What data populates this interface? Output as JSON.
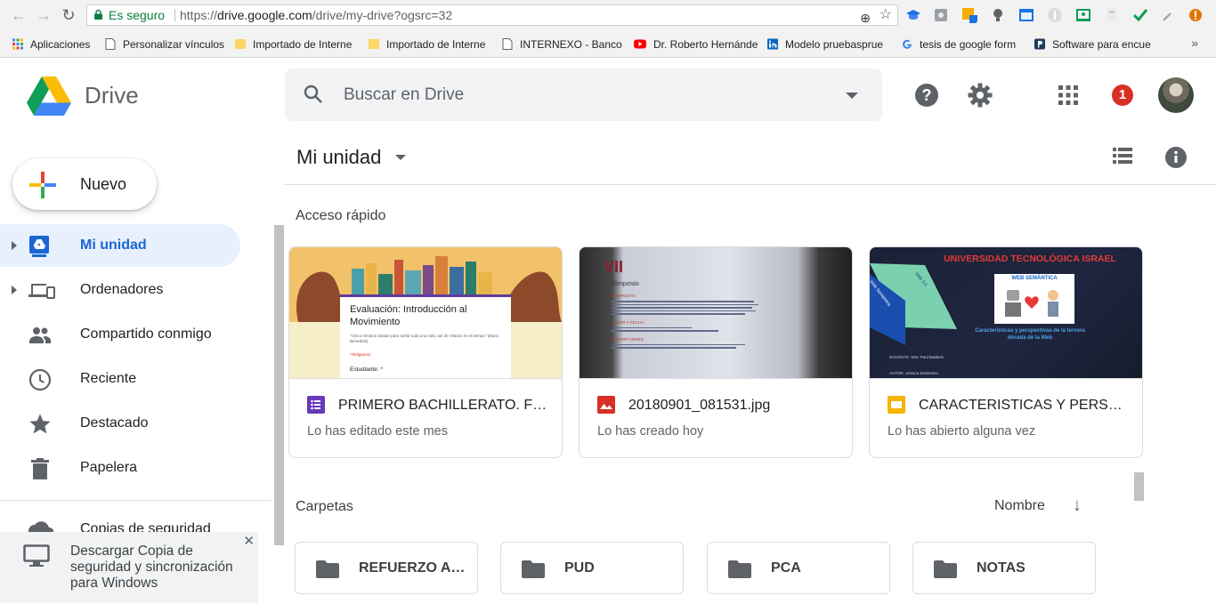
{
  "browser": {
    "secure_label": "Es seguro",
    "url_prefix": "https://",
    "url_host": "drive.google.com",
    "url_path": "/drive/my-drive?ogsrc=32",
    "bookmarks": [
      {
        "label": "Aplicaciones"
      },
      {
        "label": "Personalizar vínculos"
      },
      {
        "label": "Importado de Interne"
      },
      {
        "label": "Importado de Interne"
      },
      {
        "label": "INTERNEXO - Banco d"
      },
      {
        "label": "Dr. Roberto Hernánde"
      },
      {
        "label": "Modelo pruebasprue"
      },
      {
        "label": "tesis de google form"
      },
      {
        "label": "Software para encue"
      }
    ],
    "more": "»"
  },
  "header": {
    "brand": "Drive",
    "search_placeholder": "Buscar en Drive",
    "notification_count": "1"
  },
  "sidebar": {
    "new_label": "Nuevo",
    "items": [
      {
        "label": "Mi unidad"
      },
      {
        "label": "Ordenadores"
      },
      {
        "label": "Compartido conmigo"
      },
      {
        "label": "Reciente"
      },
      {
        "label": "Destacado"
      },
      {
        "label": "Papelera"
      }
    ],
    "backup_label": "Copias de seguridad",
    "promo_text": "Descargar Copia de seguridad y sincronización para Windows",
    "promo_close": "✕"
  },
  "main": {
    "breadcrumb": "Mi unidad",
    "quick_access_title": "Acceso rápido",
    "cards": [
      {
        "title": "PRIMERO BACHILLERATO. FÍSICA",
        "subtitle": "Lo has editado este mes",
        "icon": "forms-icon",
        "icon_color": "#673ab7",
        "thumb_heading": "Evaluación: Introducción al Movimiento",
        "thumb_quote": "\"Cinco minutos bastan para soñar toda una vida, así de relativo es el tiempo\" (Mario Benedetti)",
        "thumb_required": "*Obligatorio",
        "thumb_field": "Estudiante: *"
      },
      {
        "title": "20180901_081531.jpg",
        "subtitle": "Lo has creado hoy",
        "icon": "image-icon",
        "icon_color": "#d93025",
        "thumb_heading": "Simposio",
        "thumb_labels": [
          "PROPÓSITO",
          "LUGAR Y FECHA:",
          "INSCRIPCIONES:"
        ]
      },
      {
        "title": "CARACTERISTICAS Y PERSPECTIVAS",
        "subtitle": "Lo has abierto alguna vez",
        "icon": "slides-icon",
        "icon_color": "#f4b400",
        "thumb_heading": "UNIVERSIDAD TECNOLÓGICA ISRAEL",
        "thumb_web": "Web Semántica",
        "thumb_web3": "Web 3.0",
        "thumb_banner": "WEB SEMÁNTICA",
        "thumb_caption": "Características y perspectivas de la tercera década de la Web",
        "thumb_docente": "DOCENTE: MSc Paul Baldeón",
        "thumb_autor": "AUTOR: Jessica Zambrano"
      }
    ],
    "folders_title": "Carpetas",
    "sort_label": "Nombre",
    "folders": [
      {
        "label": "REFUERZO ACADÉMICO"
      },
      {
        "label": "PUD"
      },
      {
        "label": "PCA"
      },
      {
        "label": "NOTAS"
      }
    ]
  },
  "colors": {
    "accent": "#1967d2",
    "active_bg": "#e8f0fe",
    "notification": "#d93025"
  }
}
